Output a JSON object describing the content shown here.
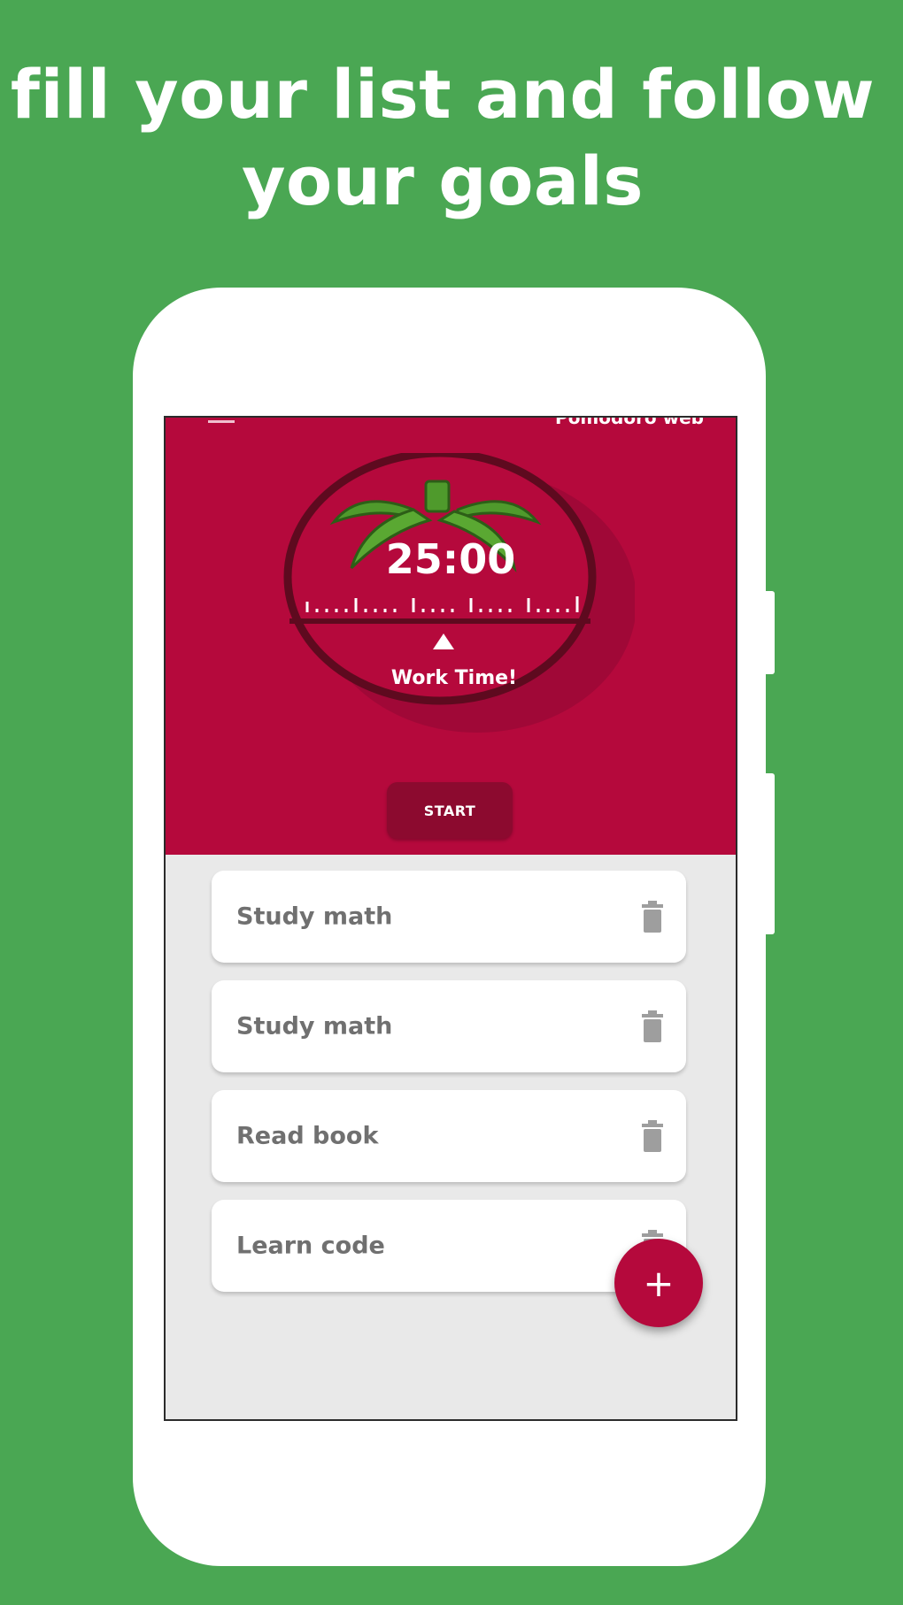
{
  "headline": {
    "line1": "fill your list and follow",
    "line2": "your goals"
  },
  "app": {
    "title": "Pomodoro web",
    "timer": "25:00",
    "mode_label": "Work Time!",
    "start_label": "START",
    "add_label": "+"
  },
  "tasks": [
    {
      "label": "Study math",
      "action_icon": "trash-icon"
    },
    {
      "label": "Study math",
      "action_icon": "trash-icon"
    },
    {
      "label": "Read book",
      "action_icon": "trash-icon"
    },
    {
      "label": "Learn code",
      "action_icon": "trash-icon"
    }
  ],
  "colors": {
    "background": "#4aa753",
    "brand": "#b5093c",
    "start_button": "#8c0a2f",
    "list_background": "#e9e9e9",
    "task_text": "#707070"
  }
}
